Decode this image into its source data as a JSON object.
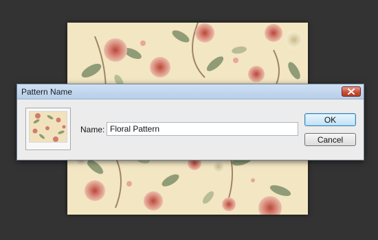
{
  "dialog": {
    "title": "Pattern Name",
    "name_label": "Name:",
    "name_value": "Floral Pattern",
    "ok_label": "OK",
    "cancel_label": "Cancel"
  },
  "icons": {
    "close": "close-icon"
  },
  "colors": {
    "workspace_bg": "#333333",
    "canvas_cream": "#f3e6c2",
    "rose": "#d58a7a",
    "leaf": "#7f8f6a",
    "default_button_border": "#3c7fb1"
  }
}
